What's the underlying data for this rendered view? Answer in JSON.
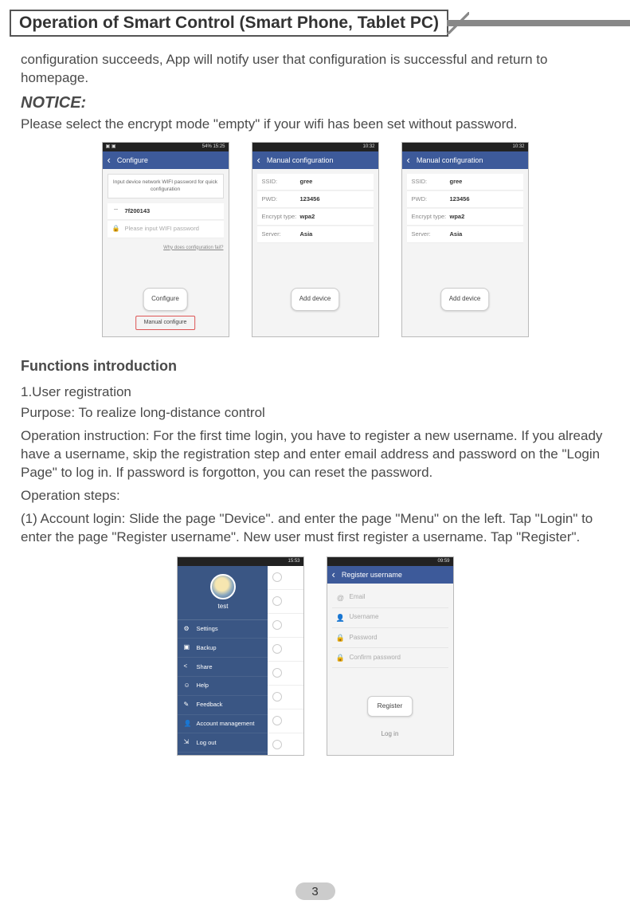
{
  "header": {
    "title": "Operation of Smart Control (Smart Phone, Tablet PC)"
  },
  "intro_para": "configuration succeeds, App will notify user that configuration is successful and return to homepage.",
  "notice_label": "NOTICE:",
  "notice_text": "Please select the encrypt mode \"empty\" if your wifi has been set without password.",
  "screens_top": {
    "s1": {
      "status_left": "▣ ▣",
      "status_right": "54% 15:25",
      "title": "Configure",
      "info": "Input device network WIFI password for quick configuration",
      "wifi_icon": "⌔",
      "wifi_ssid": "7f200143",
      "pw_icon": "🔒",
      "pw_placeholder": "Please input WIFI password",
      "fail_link": "Why does configuration fail?",
      "primary_btn": "Configure",
      "secondary_btn": "Manual configure"
    },
    "s2": {
      "status_right": "10:32",
      "title": "Manual configuration",
      "rows": [
        {
          "label": "SSID:",
          "val": "gree"
        },
        {
          "label": "PWD:",
          "val": "123456"
        },
        {
          "label": "Encrypt type:",
          "val": "wpa2"
        },
        {
          "label": "Server:",
          "val": "Asia"
        }
      ],
      "primary_btn": "Add device"
    },
    "s3": {
      "status_right": "10:32",
      "title": "Manual configuration",
      "rows": [
        {
          "label": "SSID:",
          "val": "gree"
        },
        {
          "label": "PWD:",
          "val": "123456"
        },
        {
          "label": "Encrypt type:",
          "val": "wpa2"
        },
        {
          "label": "Server:",
          "val": "Asia"
        }
      ],
      "primary_btn": "Add device"
    }
  },
  "functions_heading": "Functions introduction",
  "user_reg_heading": "1.User registration",
  "purpose": "Purpose: To realize long-distance control",
  "op_instruction": "Operation instruction: For the first time login, you have to register a new username. If you already have a username, skip the registration step and enter email address and password on the \"Login Page\" to log in. If password is forgotton, you can reset the password.",
  "op_steps_label": "Operation steps:",
  "op_step1": "(1) Account login: Slide the page \"Device\". and enter the page \"Menu\" on the left. Tap \"Login\" to enter the page \"Register username\". New user must first register a username. Tap \"Register\".",
  "screens_bottom": {
    "menu": {
      "status_right": "15:53",
      "username": "test",
      "items": [
        {
          "icon": "⚙",
          "label": "Settings"
        },
        {
          "icon": "▣",
          "label": "Backup"
        },
        {
          "icon": "<",
          "label": "Share"
        },
        {
          "icon": "☺",
          "label": "Help"
        },
        {
          "icon": "✎",
          "label": "Feedback"
        },
        {
          "icon": "👤",
          "label": "Account management"
        },
        {
          "icon": "⇲",
          "label": "Log out"
        }
      ]
    },
    "register": {
      "status_right": "09:59",
      "title": "Register username",
      "fields": [
        {
          "icon": "@",
          "placeholder": "Email"
        },
        {
          "icon": "👤",
          "placeholder": "Username"
        },
        {
          "icon": "🔒",
          "placeholder": "Password"
        },
        {
          "icon": "🔒",
          "placeholder": "Confirm password"
        }
      ],
      "primary_btn": "Register",
      "login_link": "Log in"
    }
  },
  "page_number": "3"
}
